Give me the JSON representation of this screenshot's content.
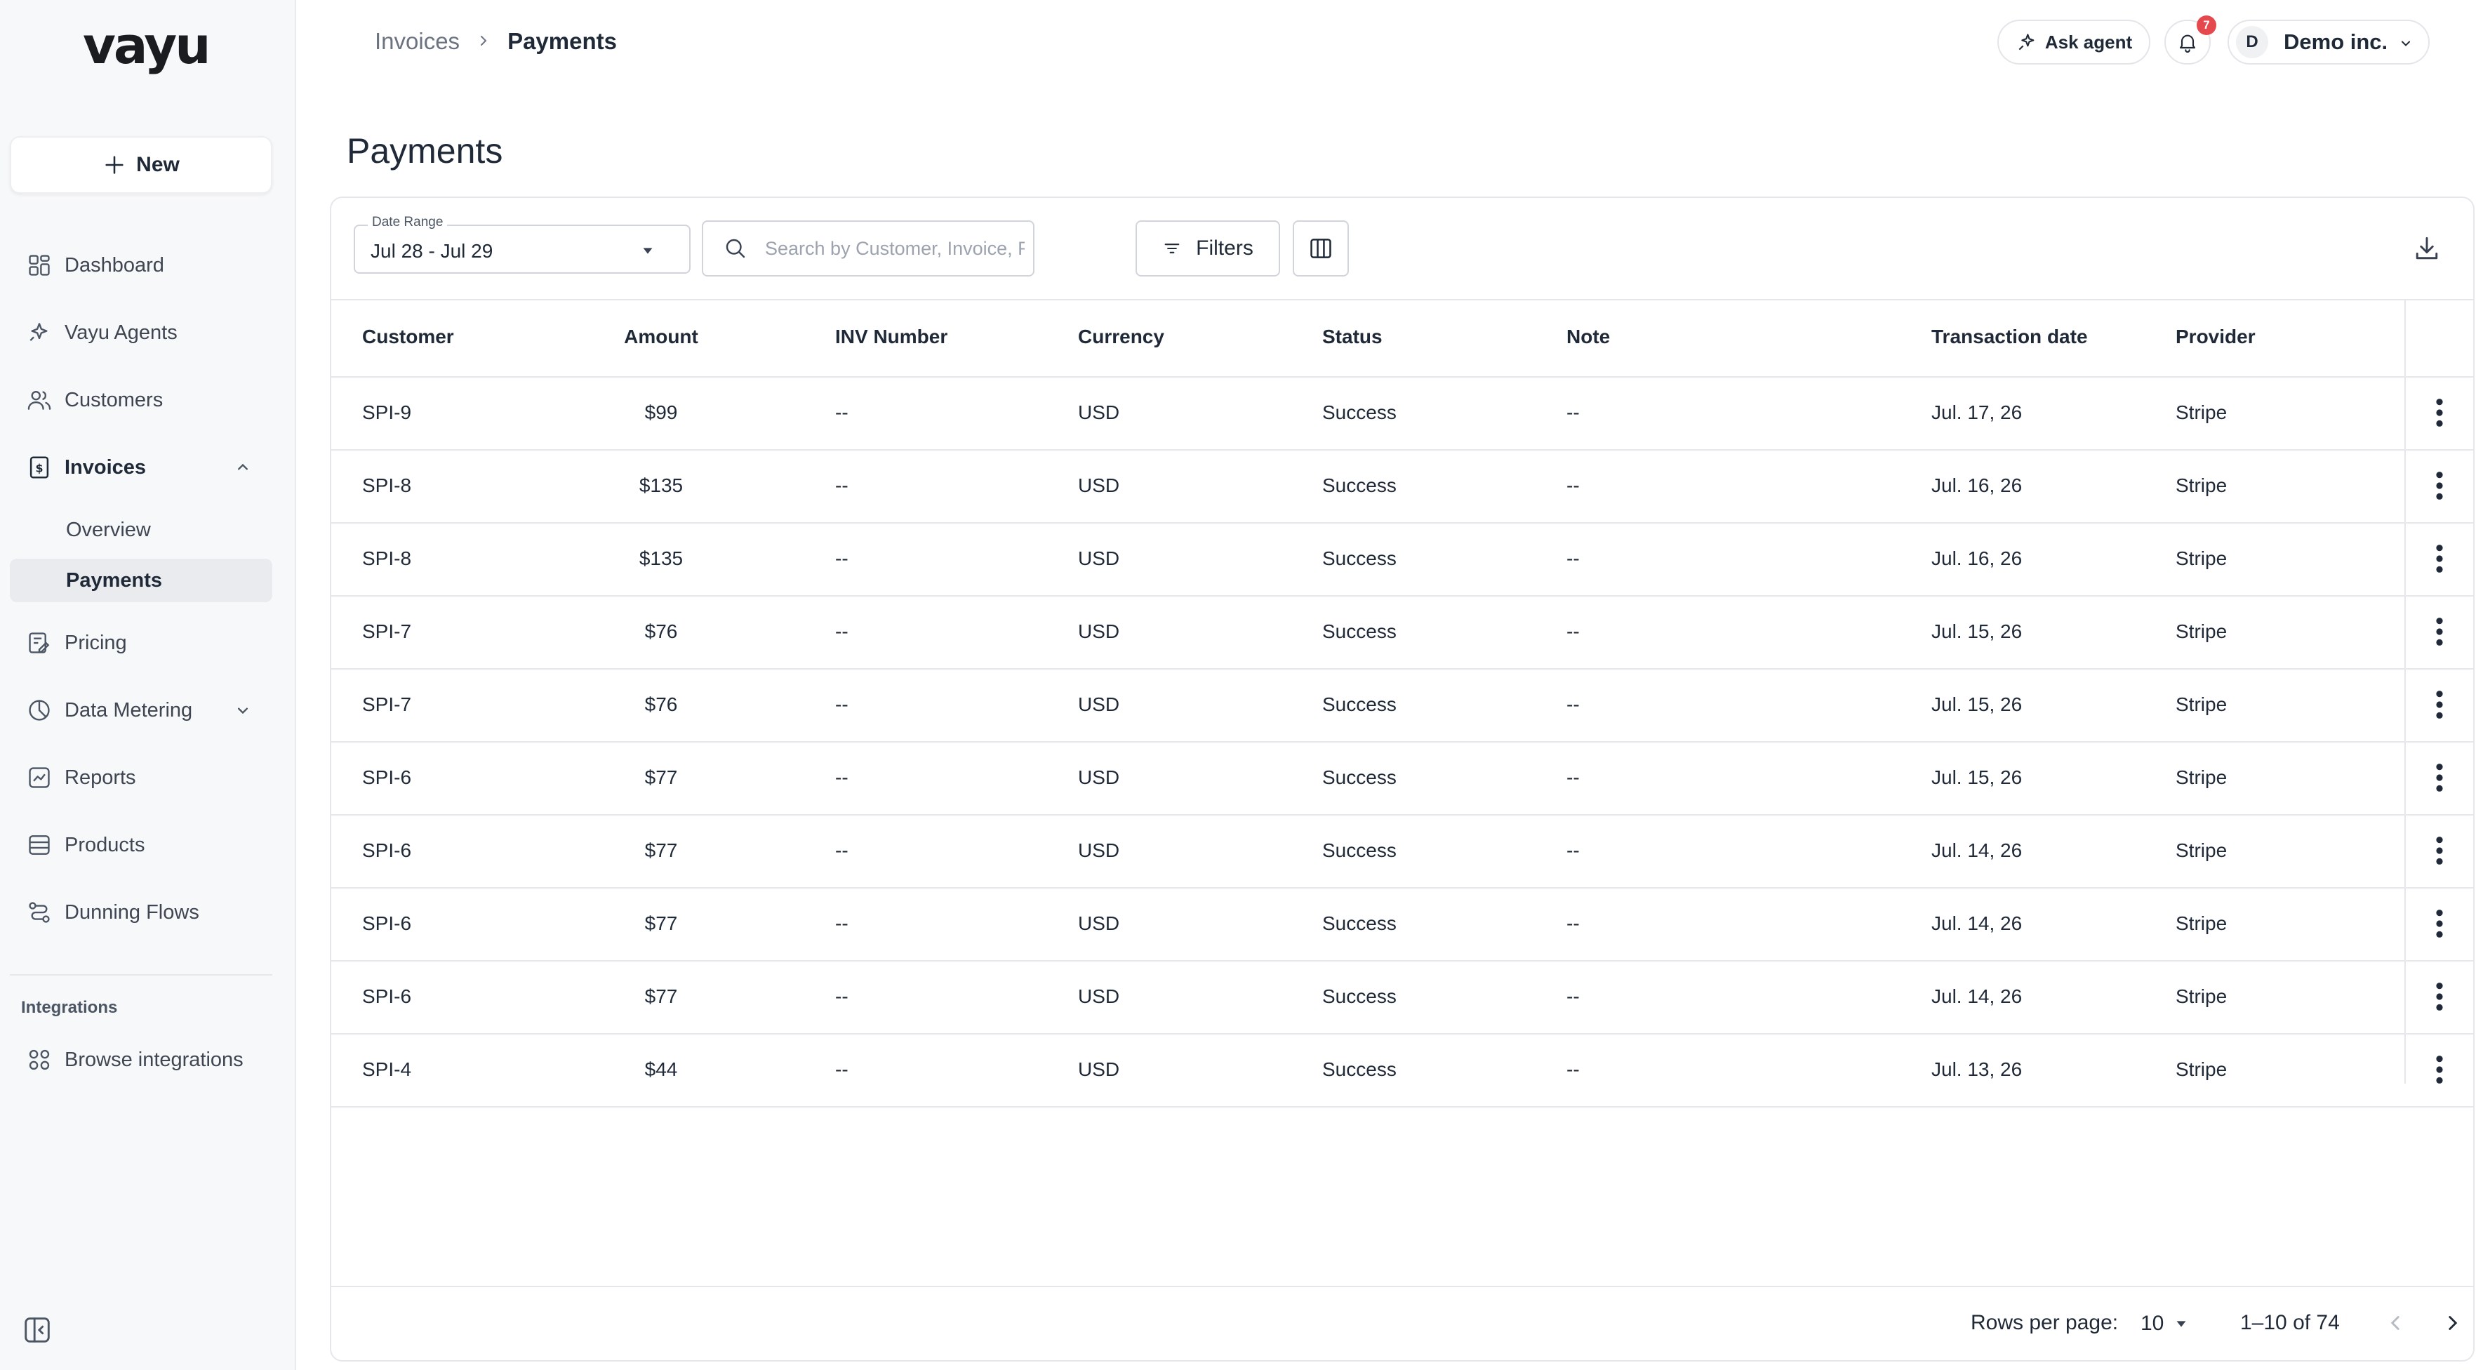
{
  "brand": {
    "logo_text": "vayu"
  },
  "sidebar": {
    "new_label": "New",
    "items": [
      {
        "label": "Dashboard",
        "icon": "dashboard-icon"
      },
      {
        "label": "Vayu Agents",
        "icon": "sparkle-icon"
      },
      {
        "label": "Customers",
        "icon": "users-icon"
      },
      {
        "label": "Invoices",
        "icon": "invoice-icon",
        "expanded": true
      },
      {
        "label": "Pricing",
        "icon": "pricing-icon"
      },
      {
        "label": "Data Metering",
        "icon": "metering-icon",
        "expanded": false
      },
      {
        "label": "Reports",
        "icon": "reports-icon"
      },
      {
        "label": "Products",
        "icon": "products-icon"
      },
      {
        "label": "Dunning Flows",
        "icon": "dunning-icon"
      }
    ],
    "invoice_subitems": [
      {
        "label": "Overview"
      },
      {
        "label": "Payments",
        "active": true
      }
    ],
    "integrations_section": "Integrations",
    "browse_integrations": "Browse integrations"
  },
  "header": {
    "breadcrumb": [
      "Invoices",
      "Payments"
    ],
    "ask_agent_label": "Ask agent",
    "notification_count": "7",
    "account_initial": "D",
    "account_name": "Demo inc."
  },
  "page": {
    "title": "Payments"
  },
  "toolbar": {
    "date_range_label": "Date Range",
    "date_range_value": "Jul 28 - Jul 29",
    "search_placeholder": "Search by Customer, Invoice, Reference",
    "filters_label": "Filters"
  },
  "table": {
    "columns": [
      "Customer",
      "Amount",
      "INV Number",
      "Currency",
      "Status",
      "Note",
      "Transaction date",
      "Provider"
    ],
    "rows": [
      [
        "SPI-9",
        "$99",
        "--",
        "USD",
        "Success",
        "--",
        "Jul. 17, 26",
        "Stripe"
      ],
      [
        "SPI-8",
        "$135",
        "--",
        "USD",
        "Success",
        "--",
        "Jul. 16, 26",
        "Stripe"
      ],
      [
        "SPI-8",
        "$135",
        "--",
        "USD",
        "Success",
        "--",
        "Jul. 16, 26",
        "Stripe"
      ],
      [
        "SPI-7",
        "$76",
        "--",
        "USD",
        "Success",
        "--",
        "Jul. 15, 26",
        "Stripe"
      ],
      [
        "SPI-7",
        "$76",
        "--",
        "USD",
        "Success",
        "--",
        "Jul. 15, 26",
        "Stripe"
      ],
      [
        "SPI-6",
        "$77",
        "--",
        "USD",
        "Success",
        "--",
        "Jul. 15, 26",
        "Stripe"
      ],
      [
        "SPI-6",
        "$77",
        "--",
        "USD",
        "Success",
        "--",
        "Jul. 14, 26",
        "Stripe"
      ],
      [
        "SPI-6",
        "$77",
        "--",
        "USD",
        "Success",
        "--",
        "Jul. 14, 26",
        "Stripe"
      ],
      [
        "SPI-6",
        "$77",
        "--",
        "USD",
        "Success",
        "--",
        "Jul. 14, 26",
        "Stripe"
      ],
      [
        "SPI-4",
        "$44",
        "--",
        "USD",
        "Success",
        "--",
        "Jul. 13, 26",
        "Stripe"
      ]
    ]
  },
  "pagination": {
    "rows_per_page_label": "Rows per page:",
    "rows_per_page_value": "10",
    "range_text": "1–10 of 74"
  }
}
